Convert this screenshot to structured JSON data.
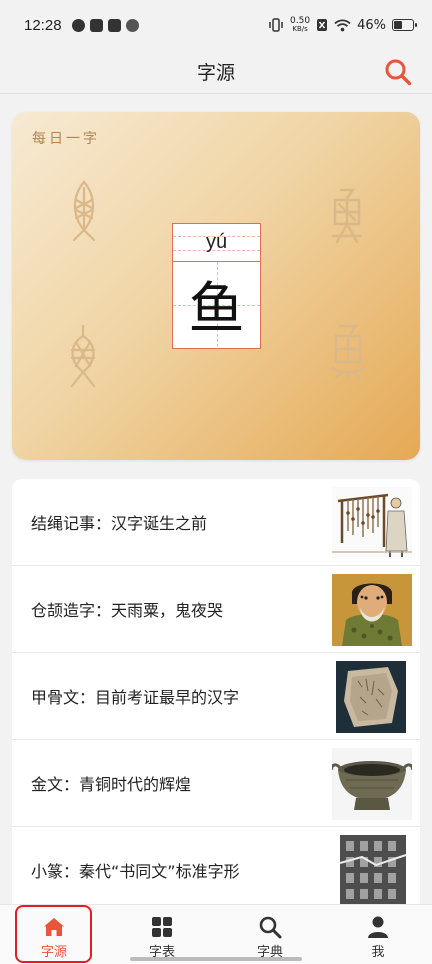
{
  "status_bar": {
    "time": "12:28",
    "net_speed_value": "0.50",
    "net_speed_unit": "KB/s",
    "battery_percent": "46%",
    "battery_level": 0.46
  },
  "nav": {
    "title": "字源"
  },
  "daily_card": {
    "label": "每日一字",
    "pinyin": "yú",
    "character": "鱼"
  },
  "articles": [
    {
      "title": "结绳记事：汉字诞生之前",
      "thumb": "knotted-rope-illustration"
    },
    {
      "title": "仓颉造字：天雨粟，鬼夜哭",
      "thumb": "cangjie-portrait"
    },
    {
      "title": "甲骨文：目前考证最早的汉字",
      "thumb": "oracle-bone-fragment"
    },
    {
      "title": "金文：青铜时代的辉煌",
      "thumb": "bronze-vessel"
    },
    {
      "title": "小篆：秦代“书同文”标准字形",
      "thumb": "stone-inscription-rubbing"
    }
  ],
  "tabs": [
    {
      "label": "字源",
      "icon": "home-icon",
      "active": true
    },
    {
      "label": "字表",
      "icon": "grid-icon",
      "active": false
    },
    {
      "label": "字典",
      "icon": "search-icon",
      "active": false
    },
    {
      "label": "我",
      "icon": "person-icon",
      "active": false
    }
  ],
  "colors": {
    "accent": "#e8553a",
    "highlight_outline": "#e02020"
  }
}
